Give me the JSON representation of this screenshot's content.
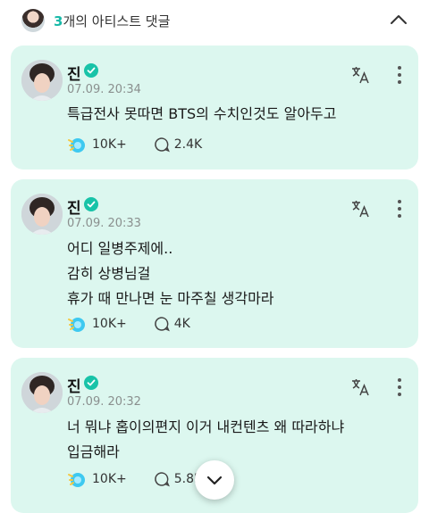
{
  "header": {
    "count": "3",
    "label": "개의 아티스트 댓글"
  },
  "comments": [
    {
      "name": "진",
      "time": "07.09. 20:34",
      "text": "특급전사 못따면 BTS의 수치인것도 알아두고",
      "likes": "10K+",
      "replies": "2.4K"
    },
    {
      "name": "진",
      "time": "07.09. 20:33",
      "text": "어디 일병주제에..\n감히 상병님걸\n휴가 때 만나면 눈 마주칠 생각마라",
      "likes": "10K+",
      "replies": "4K"
    },
    {
      "name": "진",
      "time": "07.09. 20:32",
      "text": "너 뭐냐 홉이의편지 이거 내컨텐츠 왜 따라하냐\n입금해라",
      "likes": "10K+",
      "replies": "5.8K"
    }
  ],
  "colors": {
    "accent": "#18b9a8",
    "card_bg": "#dcf7ef",
    "verified": "#18c3a8"
  }
}
